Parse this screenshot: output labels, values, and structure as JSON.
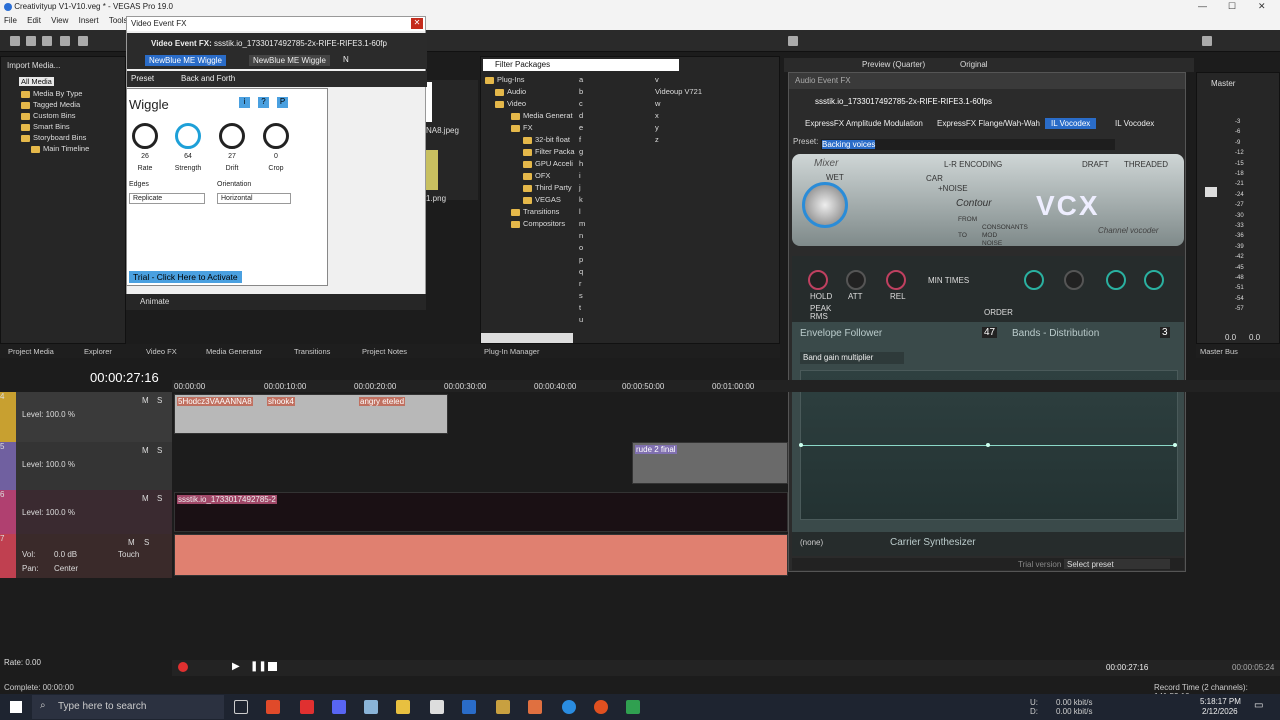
{
  "window": {
    "title": "Creativityup V1-V10.veg * - VEGAS Pro 19.0"
  },
  "menu": [
    "File",
    "Edit",
    "View",
    "Insert",
    "Tools"
  ],
  "vfx_dialog": {
    "title": "Video Event FX",
    "label": "Video Event FX:",
    "event": "ssstik.io_1733017492785-2x-RIFE-RIFE3.1-60fp",
    "chain": [
      "NewBlue ME Wiggle",
      "NewBlue ME Wiggle",
      "N"
    ],
    "preset_label": "Preset",
    "preset_value": "Back and Forth",
    "plugin_title": "Wiggle",
    "buttons": [
      "i",
      "?",
      "P"
    ],
    "knobs": [
      {
        "value": "26",
        "label": "Rate"
      },
      {
        "value": "64",
        "label": "Strength"
      },
      {
        "value": "27",
        "label": "Drift"
      },
      {
        "value": "0",
        "label": "Crop"
      }
    ],
    "edges_label": "Edges",
    "edges_value": "Replicate",
    "orientation_label": "Orientation",
    "orientation_value": "Horizontal",
    "trial": "Trial - Click Here to Activate",
    "animate": "Animate"
  },
  "project_media": {
    "import": "Import Media...",
    "tree": [
      "All Media",
      "Media By Type",
      "Tagged Media",
      "Custom Bins",
      "Smart Bins",
      "Storyboard Bins",
      "Main Timeline"
    ],
    "files": [
      "NA8.jpeg",
      "1.png"
    ]
  },
  "bottom_tabs": [
    "Project Media",
    "Explorer",
    "Video FX",
    "Media Generator",
    "Transitions",
    "Project Notes"
  ],
  "filter_packages": {
    "title": "Filter Packages",
    "tree": [
      "Plug-Ins",
      "Audio",
      "Video",
      "Media Generat",
      "FX",
      "32-bit float",
      "Filter Packa",
      "GPU Acceli",
      "OFX",
      "Third Party",
      "VEGAS",
      "Transitions",
      "Compositors"
    ],
    "letters_a": [
      "a",
      "b",
      "c",
      "d",
      "e",
      "f",
      "g",
      "h",
      "i",
      "j",
      "k",
      "l",
      "m",
      "n",
      "o",
      "p",
      "q",
      "r",
      "s",
      "t",
      "u"
    ],
    "letters_b": [
      "v",
      "Videoup V721",
      "w",
      "x",
      "y",
      "z"
    ],
    "tab": "Plug-In Manager"
  },
  "preview": {
    "quality": "Preview (Quarter)",
    "original": "Original"
  },
  "audio_fx": {
    "title": "Audio Event FX",
    "event": "ssstik.io_1733017492785-2x-RIFE-RIFE3.1-60fps",
    "chain": [
      "ExpressFX Amplitude Modulation",
      "ExpressFX Flange/Wah-Wah",
      "IL Vocodex",
      "IL Vocodex"
    ],
    "preset_label": "Preset:",
    "preset_value": "Backing voices",
    "vcx": {
      "mixer": "Mixer",
      "wet": "WET",
      "lr": "L-R ENCODING",
      "draft": "DRAFT",
      "threaded": "THREADED",
      "noise": "+NOISE",
      "car": "CAR",
      "contour": "Contour",
      "consonants": "CONSONANTS",
      "mod": "MOD",
      "noise2": "NOISE",
      "from": "FROM",
      "to": "TO",
      "logo": "VCX",
      "sub": "Channel vocoder"
    },
    "knobs": [
      "HOLD",
      "ATT",
      "REL",
      "MIN TIMES",
      "ORDER"
    ],
    "peak": "PEAK",
    "rms": "RMS",
    "env_title": "Envelope Follower",
    "bands": "47",
    "bands_label": "Bands - Distribution",
    "band_num": "3",
    "band_select": "Band gain multiplier",
    "carrier_none": "(none)",
    "carrier": "Carrier Synthesizer",
    "trial": "Trial version",
    "select_preset": "Select preset"
  },
  "master": {
    "label": "Master",
    "tab": "Master Bus",
    "scale": [
      "-3",
      "-6",
      "-9",
      "-12",
      "-15",
      "-18",
      "-21",
      "-24",
      "-27",
      "-30",
      "-33",
      "-36",
      "-39",
      "-42",
      "-45",
      "-48",
      "-51",
      "-54",
      "-57"
    ],
    "bottom": [
      "0.0",
      "0.0"
    ]
  },
  "timeline": {
    "timecode": "00:00:27:16",
    "ruler": [
      "00:00:00",
      "00:00:10:00",
      "00:00:20:00",
      "00:00:30:00",
      "00:00:40:00",
      "00:00:50:00",
      "00:01:00:00"
    ],
    "tracks": [
      {
        "num": "4",
        "level": "Level: 100.0 %",
        "clips": [
          "5Hodcz3VAAANNA8",
          "shook4",
          "angry eteled"
        ]
      },
      {
        "num": "5",
        "level": "Level: 100.0 %",
        "clips": [
          "rude 2 final"
        ]
      },
      {
        "num": "6",
        "level": "Level: 100.0 %",
        "clips": [
          "ssstik.io_1733017492785-2"
        ]
      },
      {
        "num": "7",
        "vol": "Vol:",
        "vol_val": "0.0 dB",
        "pan": "Pan:",
        "pan_val": "Center",
        "touch": "Touch"
      }
    ],
    "rate": "Rate: 0.00",
    "end_time": "00:00:27:16",
    "end_time2": "00:00:05:24"
  },
  "status": {
    "complete": "Complete: 00:00:00",
    "record": "Record Time (2 channels): 141:53:10"
  },
  "taskbar": {
    "search": "Type here to search",
    "time": "5:18:17 PM",
    "date": "2/12/2026",
    "net_u": "0.00 kbit/s",
    "net_d": "0.00 kbit/s",
    "u": "U:",
    "d": "D:"
  }
}
